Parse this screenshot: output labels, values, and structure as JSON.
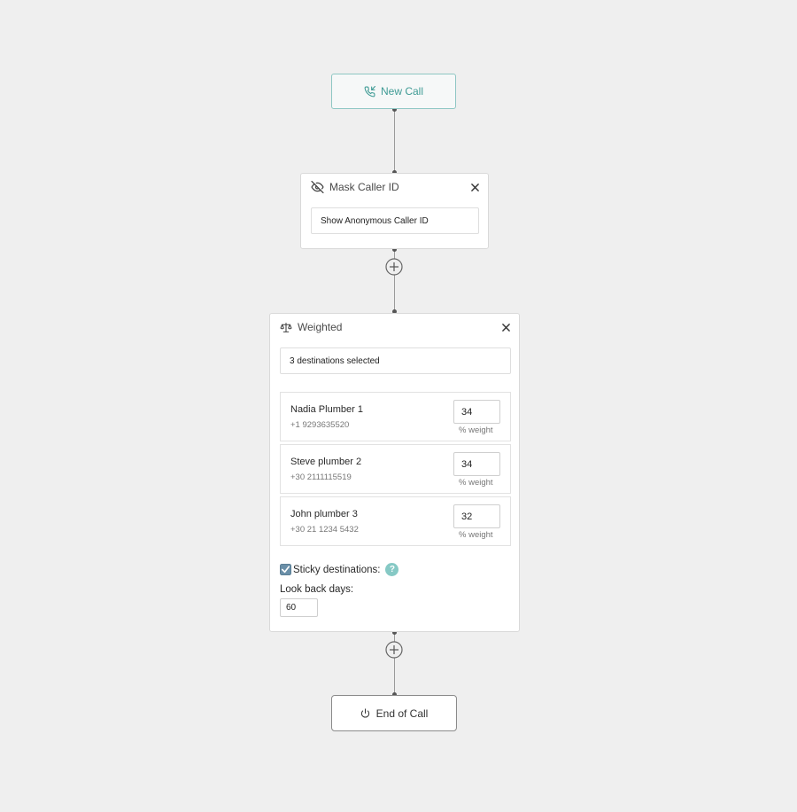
{
  "start_node": {
    "label": "New Call",
    "icon": "phone-incoming-icon"
  },
  "mask_caller_id": {
    "title": "Mask Caller ID",
    "icon": "eye-off-icon",
    "option_value": "Show Anonymous Caller ID"
  },
  "weighted": {
    "title": "Weighted",
    "icon": "scale-icon",
    "selection_summary": "3 destinations selected",
    "destinations": [
      {
        "name": "Nadia Plumber 1",
        "phone": "+1 9293635520",
        "weight": "34",
        "unit": "% weight"
      },
      {
        "name": "Steve plumber 2",
        "phone": "+30 2111115519",
        "weight": "34",
        "unit": "% weight"
      },
      {
        "name": "John plumber 3",
        "phone": "+30 21 1234 5432",
        "weight": "32",
        "unit": "% weight"
      }
    ],
    "sticky_label": "Sticky destinations:",
    "sticky_checked": true,
    "help_symbol": "?",
    "look_back_label": "Look back days:",
    "look_back_value": "60"
  },
  "end_node": {
    "label": "End of Call",
    "icon": "power-icon"
  },
  "colors": {
    "accent": "#3f9b95",
    "help_badge": "#86c9c5",
    "canvas": "#efefef"
  }
}
